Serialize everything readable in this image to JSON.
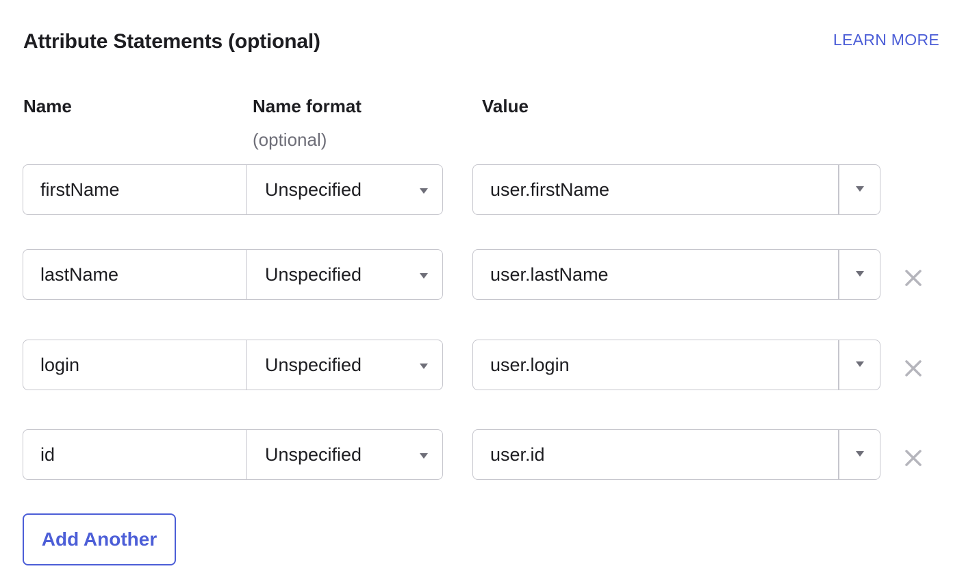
{
  "section": {
    "title": "Attribute Statements (optional)",
    "learn_more": "LEARN MORE"
  },
  "columns": {
    "name": "Name",
    "name_format": "Name format",
    "name_format_note": "(optional)",
    "value": "Value"
  },
  "rows": [
    {
      "name": "firstName",
      "format": "Unspecified",
      "value": "user.firstName",
      "removable": false
    },
    {
      "name": "lastName",
      "format": "Unspecified",
      "value": "user.lastName",
      "removable": true
    },
    {
      "name": "login",
      "format": "Unspecified",
      "value": "user.login",
      "removable": true
    },
    {
      "name": "id",
      "format": "Unspecified",
      "value": "user.id",
      "removable": true
    }
  ],
  "add_button": "Add Another",
  "colors": {
    "accent": "#4c5ed7",
    "border": "#c6c6cd",
    "text": "#1d1d21",
    "muted": "#6e6e78",
    "remove_icon": "#b5b5bc"
  },
  "icons": {
    "format_dropdown": "chevron-down-icon",
    "value_dropdown": "chevron-down-icon",
    "remove": "close-icon"
  }
}
